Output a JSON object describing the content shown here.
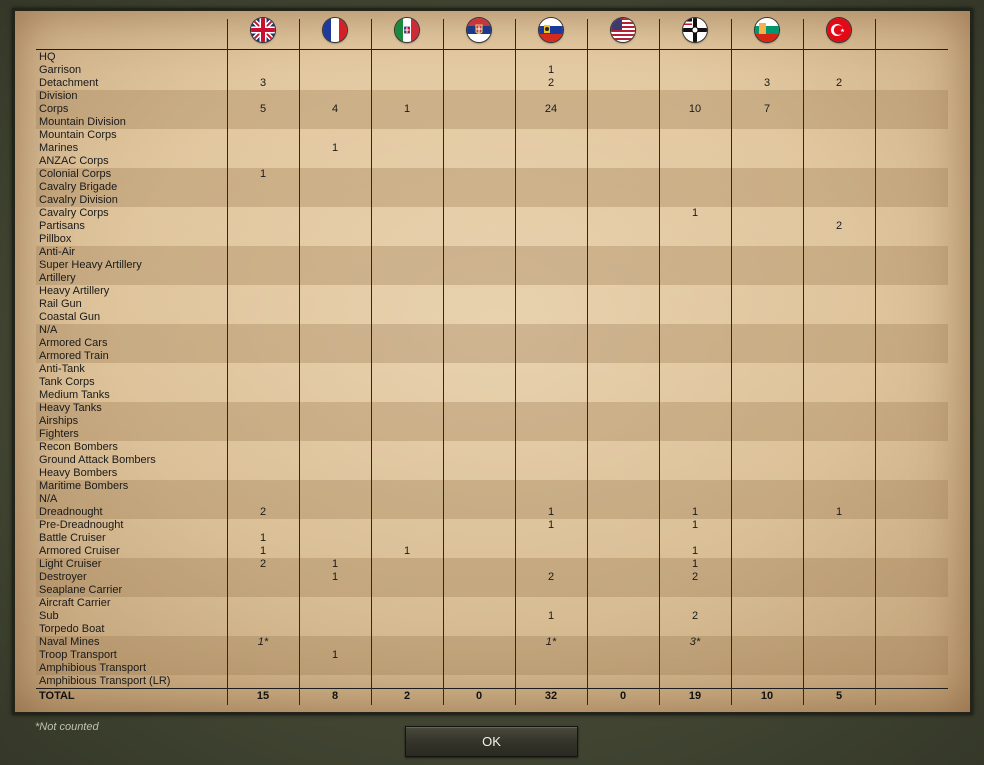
{
  "columns": [
    {
      "nation": "United Kingdom",
      "flag_icon": "uk-flag-icon"
    },
    {
      "nation": "France",
      "flag_icon": "france-flag-icon"
    },
    {
      "nation": "Italy",
      "flag_icon": "italy-flag-icon"
    },
    {
      "nation": "Serbia",
      "flag_icon": "serbia-flag-icon"
    },
    {
      "nation": "Russia",
      "flag_icon": "russia-flag-icon"
    },
    {
      "nation": "United States",
      "flag_icon": "usa-flag-icon"
    },
    {
      "nation": "Germany",
      "flag_icon": "germany-flag-icon"
    },
    {
      "nation": "Bulgaria",
      "flag_icon": "bulgaria-flag-icon"
    },
    {
      "nation": "Ottoman Empire",
      "flag_icon": "ottoman-flag-icon"
    }
  ],
  "rows": [
    {
      "label": "HQ",
      "values": [
        "",
        "",
        "",
        "",
        "",
        "",
        "",
        "",
        ""
      ]
    },
    {
      "label": "Garrison",
      "values": [
        "",
        "",
        "",
        "",
        "1",
        "",
        "",
        "",
        ""
      ]
    },
    {
      "label": "Detachment",
      "values": [
        "3",
        "",
        "",
        "",
        "2",
        "",
        "",
        "3",
        "2"
      ]
    },
    {
      "label": "Division",
      "values": [
        "",
        "",
        "",
        "",
        "",
        "",
        "",
        "",
        ""
      ]
    },
    {
      "label": "Corps",
      "values": [
        "5",
        "4",
        "1",
        "",
        "24",
        "",
        "10",
        "7",
        ""
      ]
    },
    {
      "label": "Mountain Division",
      "values": [
        "",
        "",
        "",
        "",
        "",
        "",
        "",
        "",
        ""
      ]
    },
    {
      "label": "Mountain Corps",
      "values": [
        "",
        "",
        "",
        "",
        "",
        "",
        "",
        "",
        ""
      ]
    },
    {
      "label": "Marines",
      "values": [
        "",
        "1",
        "",
        "",
        "",
        "",
        "",
        "",
        ""
      ]
    },
    {
      "label": "ANZAC Corps",
      "values": [
        "",
        "",
        "",
        "",
        "",
        "",
        "",
        "",
        ""
      ]
    },
    {
      "label": "Colonial Corps",
      "values": [
        "1",
        "",
        "",
        "",
        "",
        "",
        "",
        "",
        ""
      ]
    },
    {
      "label": "Cavalry Brigade",
      "values": [
        "",
        "",
        "",
        "",
        "",
        "",
        "",
        "",
        ""
      ]
    },
    {
      "label": "Cavalry Division",
      "values": [
        "",
        "",
        "",
        "",
        "",
        "",
        "",
        "",
        ""
      ]
    },
    {
      "label": "Cavalry Corps",
      "values": [
        "",
        "",
        "",
        "",
        "",
        "",
        "1",
        "",
        ""
      ]
    },
    {
      "label": "Partisans",
      "values": [
        "",
        "",
        "",
        "",
        "",
        "",
        "",
        "",
        "2"
      ]
    },
    {
      "label": "Pillbox",
      "values": [
        "",
        "",
        "",
        "",
        "",
        "",
        "",
        "",
        ""
      ]
    },
    {
      "label": "Anti-Air",
      "values": [
        "",
        "",
        "",
        "",
        "",
        "",
        "",
        "",
        ""
      ]
    },
    {
      "label": "Super Heavy Artillery",
      "values": [
        "",
        "",
        "",
        "",
        "",
        "",
        "",
        "",
        ""
      ]
    },
    {
      "label": "Artillery",
      "values": [
        "",
        "",
        "",
        "",
        "",
        "",
        "",
        "",
        ""
      ]
    },
    {
      "label": "Heavy Artillery",
      "values": [
        "",
        "",
        "",
        "",
        "",
        "",
        "",
        "",
        ""
      ]
    },
    {
      "label": "Rail Gun",
      "values": [
        "",
        "",
        "",
        "",
        "",
        "",
        "",
        "",
        ""
      ]
    },
    {
      "label": "Coastal Gun",
      "values": [
        "",
        "",
        "",
        "",
        "",
        "",
        "",
        "",
        ""
      ]
    },
    {
      "label": "N/A",
      "values": [
        "",
        "",
        "",
        "",
        "",
        "",
        "",
        "",
        ""
      ]
    },
    {
      "label": "Armored Cars",
      "values": [
        "",
        "",
        "",
        "",
        "",
        "",
        "",
        "",
        ""
      ]
    },
    {
      "label": "Armored Train",
      "values": [
        "",
        "",
        "",
        "",
        "",
        "",
        "",
        "",
        ""
      ]
    },
    {
      "label": "Anti-Tank",
      "values": [
        "",
        "",
        "",
        "",
        "",
        "",
        "",
        "",
        ""
      ]
    },
    {
      "label": "Tank Corps",
      "values": [
        "",
        "",
        "",
        "",
        "",
        "",
        "",
        "",
        ""
      ]
    },
    {
      "label": "Medium Tanks",
      "values": [
        "",
        "",
        "",
        "",
        "",
        "",
        "",
        "",
        ""
      ]
    },
    {
      "label": "Heavy Tanks",
      "values": [
        "",
        "",
        "",
        "",
        "",
        "",
        "",
        "",
        ""
      ]
    },
    {
      "label": "Airships",
      "values": [
        "",
        "",
        "",
        "",
        "",
        "",
        "",
        "",
        ""
      ]
    },
    {
      "label": "Fighters",
      "values": [
        "",
        "",
        "",
        "",
        "",
        "",
        "",
        "",
        ""
      ]
    },
    {
      "label": "Recon Bombers",
      "values": [
        "",
        "",
        "",
        "",
        "",
        "",
        "",
        "",
        ""
      ]
    },
    {
      "label": "Ground Attack Bombers",
      "values": [
        "",
        "",
        "",
        "",
        "",
        "",
        "",
        "",
        ""
      ]
    },
    {
      "label": "Heavy Bombers",
      "values": [
        "",
        "",
        "",
        "",
        "",
        "",
        "",
        "",
        ""
      ]
    },
    {
      "label": "Maritime Bombers",
      "values": [
        "",
        "",
        "",
        "",
        "",
        "",
        "",
        "",
        ""
      ]
    },
    {
      "label": "N/A",
      "values": [
        "",
        "",
        "",
        "",
        "",
        "",
        "",
        "",
        ""
      ]
    },
    {
      "label": "Dreadnought",
      "values": [
        "2",
        "",
        "",
        "",
        "1",
        "",
        "1",
        "",
        "1"
      ]
    },
    {
      "label": "Pre-Dreadnought",
      "values": [
        "",
        "",
        "",
        "",
        "1",
        "",
        "1",
        "",
        ""
      ]
    },
    {
      "label": "Battle Cruiser",
      "values": [
        "1",
        "",
        "",
        "",
        "",
        "",
        "",
        "",
        ""
      ]
    },
    {
      "label": "Armored Cruiser",
      "values": [
        "1",
        "",
        "1",
        "",
        "",
        "",
        "1",
        "",
        ""
      ]
    },
    {
      "label": "Light Cruiser",
      "values": [
        "2",
        "1",
        "",
        "",
        "",
        "",
        "1",
        "",
        ""
      ]
    },
    {
      "label": "Destroyer",
      "values": [
        "",
        "1",
        "",
        "",
        "2",
        "",
        "2",
        "",
        ""
      ]
    },
    {
      "label": "Seaplane Carrier",
      "values": [
        "",
        "",
        "",
        "",
        "",
        "",
        "",
        "",
        ""
      ]
    },
    {
      "label": "Aircraft Carrier",
      "values": [
        "",
        "",
        "",
        "",
        "",
        "",
        "",
        "",
        ""
      ]
    },
    {
      "label": "Sub",
      "values": [
        "",
        "",
        "",
        "",
        "1",
        "",
        "2",
        "",
        ""
      ]
    },
    {
      "label": "Torpedo Boat",
      "values": [
        "",
        "",
        "",
        "",
        "",
        "",
        "",
        "",
        ""
      ]
    },
    {
      "label": "Naval Mines",
      "values": [
        "1*",
        "",
        "",
        "",
        "1*",
        "",
        "3*",
        "",
        ""
      ]
    },
    {
      "label": "Troop Transport",
      "values": [
        "",
        "1",
        "",
        "",
        "",
        "",
        "",
        "",
        ""
      ]
    },
    {
      "label": "Amphibious Transport",
      "values": [
        "",
        "",
        "",
        "",
        "",
        "",
        "",
        "",
        ""
      ]
    },
    {
      "label": "Amphibious Transport (LR)",
      "values": [
        "",
        "",
        "",
        "",
        "",
        "",
        "",
        "",
        ""
      ]
    }
  ],
  "total": {
    "label": "TOTAL",
    "values": [
      "15",
      "8",
      "2",
      "0",
      "32",
      "0",
      "19",
      "10",
      "5"
    ]
  },
  "footnote": "*Not counted",
  "ok_label": "OK"
}
